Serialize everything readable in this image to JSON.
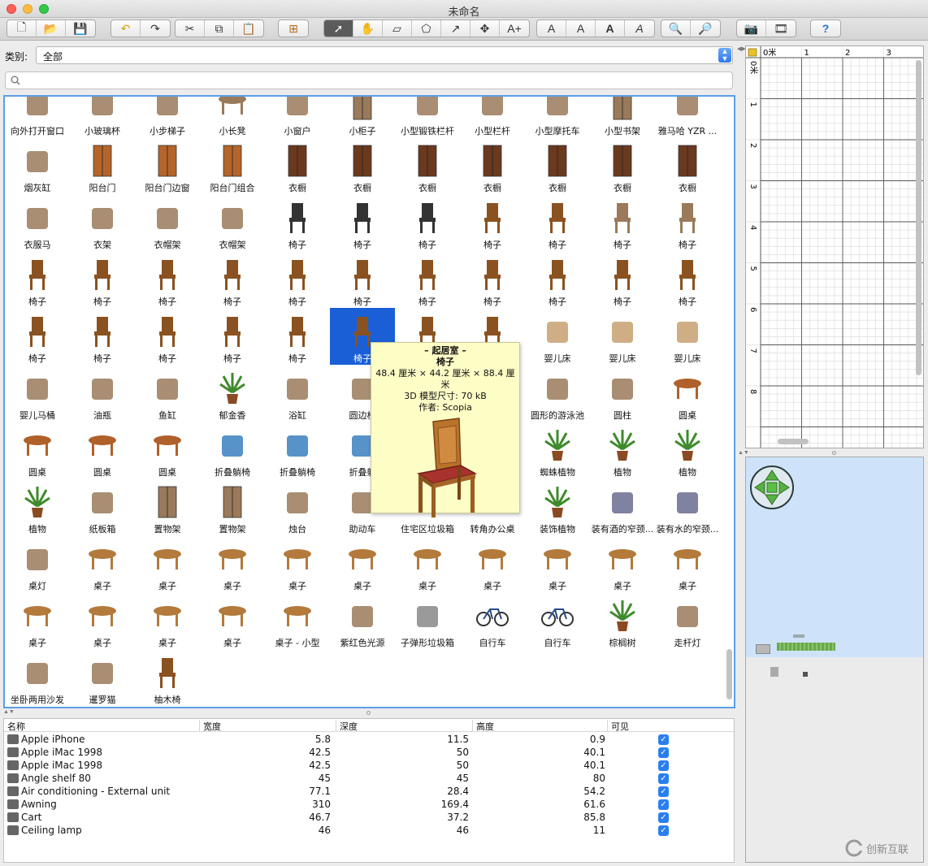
{
  "window": {
    "title": "未命名"
  },
  "category": {
    "label": "类别:",
    "value": "全部"
  },
  "search": {
    "placeholder": ""
  },
  "catalog": {
    "items": [
      {
        "label": "向外打开窗口",
        "icon": "window-icon"
      },
      {
        "label": "小玻璃杯",
        "icon": "glass-icon"
      },
      {
        "label": "小步梯子",
        "icon": "ladder-icon"
      },
      {
        "label": "小长凳",
        "icon": "bench-icon"
      },
      {
        "label": "小窗户",
        "icon": "window-icon"
      },
      {
        "label": "小柜子",
        "icon": "cabinet-icon"
      },
      {
        "label": "小型锻铁栏杆",
        "icon": "railing-icon"
      },
      {
        "label": "小型栏杆",
        "icon": "railing-icon"
      },
      {
        "label": "小型摩托车",
        "icon": "scooter-icon"
      },
      {
        "label": "小型书架",
        "icon": "bookshelf-icon"
      },
      {
        "label": "雅马哈 YZR ...",
        "icon": "motorcycle-icon"
      },
      {
        "label": "烟灰缸",
        "icon": "ashtray-icon"
      },
      {
        "label": "阳台门",
        "icon": "door-icon"
      },
      {
        "label": "阳台门边窗",
        "icon": "door-icon"
      },
      {
        "label": "阳台门组合",
        "icon": "door-icon"
      },
      {
        "label": "衣橱",
        "icon": "wardrobe-icon"
      },
      {
        "label": "衣橱",
        "icon": "wardrobe-icon"
      },
      {
        "label": "衣橱",
        "icon": "wardrobe-icon"
      },
      {
        "label": "衣橱",
        "icon": "wardrobe-icon"
      },
      {
        "label": "衣橱",
        "icon": "wardrobe-icon"
      },
      {
        "label": "衣橱",
        "icon": "wardrobe-icon"
      },
      {
        "label": "衣橱",
        "icon": "wardrobe-icon"
      },
      {
        "label": "衣服马",
        "icon": "drying-rack-icon"
      },
      {
        "label": "衣架",
        "icon": "hanger-icon"
      },
      {
        "label": "衣帽架",
        "icon": "coat-stand-icon"
      },
      {
        "label": "衣帽架",
        "icon": "coat-stand-icon"
      },
      {
        "label": "椅子",
        "icon": "office-chair-icon"
      },
      {
        "label": "椅子",
        "icon": "office-chair-icon"
      },
      {
        "label": "椅子",
        "icon": "office-chair-icon"
      },
      {
        "label": "椅子",
        "icon": "chair-icon"
      },
      {
        "label": "椅子",
        "icon": "chair-icon"
      },
      {
        "label": "椅子",
        "icon": "stool-icon"
      },
      {
        "label": "椅子",
        "icon": "sofa-chair-icon"
      },
      {
        "label": "椅子",
        "icon": "chair-icon"
      },
      {
        "label": "椅子",
        "icon": "chair-icon"
      },
      {
        "label": "椅子",
        "icon": "chair-icon"
      },
      {
        "label": "椅子",
        "icon": "chair-icon"
      },
      {
        "label": "椅子",
        "icon": "chair-icon"
      },
      {
        "label": "椅子",
        "icon": "chair-icon"
      },
      {
        "label": "椅子",
        "icon": "chair-icon"
      },
      {
        "label": "椅子",
        "icon": "chair-icon"
      },
      {
        "label": "椅子",
        "icon": "chair-icon"
      },
      {
        "label": "椅子",
        "icon": "chair-icon"
      },
      {
        "label": "椅子",
        "icon": "chair-icon"
      },
      {
        "label": "椅子",
        "icon": "chair-icon"
      },
      {
        "label": "椅子",
        "icon": "chair-icon"
      },
      {
        "label": "椅子",
        "icon": "chair-icon"
      },
      {
        "label": "椅子",
        "icon": "chair-icon"
      },
      {
        "label": "椅子",
        "icon": "chair-icon"
      },
      {
        "label": "椅子",
        "icon": "chair-icon",
        "selected": true
      },
      {
        "label": "",
        "icon": "chair-icon"
      },
      {
        "label": "",
        "icon": "chair-icon"
      },
      {
        "label": "婴儿床",
        "icon": "crib-icon"
      },
      {
        "label": "婴儿床",
        "icon": "crib-icon"
      },
      {
        "label": "婴儿床",
        "icon": "crib-icon"
      },
      {
        "label": "婴儿马桶",
        "icon": "potty-icon"
      },
      {
        "label": "油瓶",
        "icon": "bottle-icon"
      },
      {
        "label": "鱼缸",
        "icon": "fishbowl-icon"
      },
      {
        "label": "郁金香",
        "icon": "tulip-icon"
      },
      {
        "label": "浴缸",
        "icon": "bathtub-icon"
      },
      {
        "label": "圆边栏",
        "icon": "railing-icon"
      },
      {
        "label": "",
        "icon": ""
      },
      {
        "label": "",
        "icon": ""
      },
      {
        "label": "圆形的游泳池",
        "icon": "pool-icon"
      },
      {
        "label": "圆柱",
        "icon": "cylinder-icon"
      },
      {
        "label": "圆桌",
        "icon": "round-table-icon"
      },
      {
        "label": "圆桌",
        "icon": "round-table-icon"
      },
      {
        "label": "圆桌",
        "icon": "round-table-icon"
      },
      {
        "label": "圆桌",
        "icon": "round-table-icon"
      },
      {
        "label": "折叠躺椅",
        "icon": "deckchair-icon"
      },
      {
        "label": "折叠躺椅",
        "icon": "deckchair-icon"
      },
      {
        "label": "折叠躺",
        "icon": "deckchair-icon"
      },
      {
        "label": "",
        "icon": ""
      },
      {
        "label": "",
        "icon": ""
      },
      {
        "label": "蜘蛛植物",
        "icon": "plant-icon"
      },
      {
        "label": "植物",
        "icon": "plant-icon"
      },
      {
        "label": "植物",
        "icon": "plant-icon"
      },
      {
        "label": "植物",
        "icon": "plant-icon"
      },
      {
        "label": "纸板箱",
        "icon": "box-icon"
      },
      {
        "label": "置物架",
        "icon": "shelf-icon"
      },
      {
        "label": "置物架",
        "icon": "shelf-icon"
      },
      {
        "label": "烛台",
        "icon": "candle-icon"
      },
      {
        "label": "助动车",
        "icon": "moped-icon"
      },
      {
        "label": "住宅区垃圾箱",
        "icon": "bin-icon"
      },
      {
        "label": "转角办公桌",
        "icon": "desk-icon"
      },
      {
        "label": "装饰植物",
        "icon": "plant-icon"
      },
      {
        "label": "装有酒的窄颈...",
        "icon": "vase-icon"
      },
      {
        "label": "装有水的窄颈...",
        "icon": "vase-icon"
      },
      {
        "label": "桌灯",
        "icon": "lamp-icon"
      },
      {
        "label": "桌子",
        "icon": "table-icon"
      },
      {
        "label": "桌子",
        "icon": "table-icon"
      },
      {
        "label": "桌子",
        "icon": "table-icon"
      },
      {
        "label": "桌子",
        "icon": "table-icon"
      },
      {
        "label": "桌子",
        "icon": "table-icon"
      },
      {
        "label": "桌子",
        "icon": "table-icon"
      },
      {
        "label": "桌子",
        "icon": "table-icon"
      },
      {
        "label": "桌子",
        "icon": "table-icon"
      },
      {
        "label": "桌子",
        "icon": "table-icon"
      },
      {
        "label": "桌子",
        "icon": "table-icon"
      },
      {
        "label": "桌子",
        "icon": "table-icon"
      },
      {
        "label": "桌子",
        "icon": "table-icon"
      },
      {
        "label": "桌子",
        "icon": "table-icon"
      },
      {
        "label": "桌子",
        "icon": "table-icon"
      },
      {
        "label": "桌子 - 小型",
        "icon": "table-icon"
      },
      {
        "label": "紫红色光源",
        "icon": "bulb-icon"
      },
      {
        "label": "子弹形垃圾箱",
        "icon": "bin-icon"
      },
      {
        "label": "自行车",
        "icon": "bicycle-icon"
      },
      {
        "label": "自行车",
        "icon": "bicycle-icon"
      },
      {
        "label": "棕榈树",
        "icon": "palm-icon"
      },
      {
        "label": "走杆灯",
        "icon": "track-light-icon"
      },
      {
        "label": "坐卧两用沙发",
        "icon": "sofa-bed-icon"
      },
      {
        "label": "暹罗猫",
        "icon": "cat-icon"
      },
      {
        "label": "柚木椅",
        "icon": "chair-icon"
      }
    ]
  },
  "tooltip": {
    "category": "– 起居室 –",
    "name": "椅子",
    "dimensions": "48.4 厘米 × 44.2 厘米 × 88.4 厘米",
    "model_size": "3D 模型尺寸: 70 kB",
    "author": "作者: Scopia"
  },
  "furniture_table": {
    "headers": {
      "name": "名称",
      "width": "宽度",
      "depth": "深度",
      "height": "高度",
      "visible": "可见"
    },
    "rows": [
      {
        "name": "Apple iPhone",
        "width": "5.8",
        "depth": "11.5",
        "height": "0.9",
        "visible": true
      },
      {
        "name": "Apple iMac 1998",
        "width": "42.5",
        "depth": "50",
        "height": "40.1",
        "visible": true
      },
      {
        "name": "Apple iMac 1998",
        "width": "42.5",
        "depth": "50",
        "height": "40.1",
        "visible": true
      },
      {
        "name": "Angle shelf 80",
        "width": "45",
        "depth": "45",
        "height": "80",
        "visible": true
      },
      {
        "name": "Air conditioning - External unit",
        "width": "77.1",
        "depth": "28.4",
        "height": "54.2",
        "visible": true
      },
      {
        "name": "Awning",
        "width": "310",
        "depth": "169.4",
        "height": "61.6",
        "visible": true
      },
      {
        "name": "Cart",
        "width": "46.7",
        "depth": "37.2",
        "height": "85.8",
        "visible": true
      },
      {
        "name": "Ceiling lamp",
        "width": "46",
        "depth": "46",
        "height": "11",
        "visible": true
      }
    ]
  },
  "plan": {
    "x_labels": [
      "0米",
      "1",
      "2",
      "3"
    ],
    "y_labels": [
      "0米",
      "1",
      "2",
      "3",
      "4",
      "5",
      "6",
      "7",
      "8"
    ]
  },
  "watermark": {
    "text": "创新互联"
  },
  "colors": {
    "selection": "#1a5fd6",
    "sky": "#cee3fa",
    "accent": "#2a7ff0",
    "tooltip_bg": "#fdfdc6"
  }
}
